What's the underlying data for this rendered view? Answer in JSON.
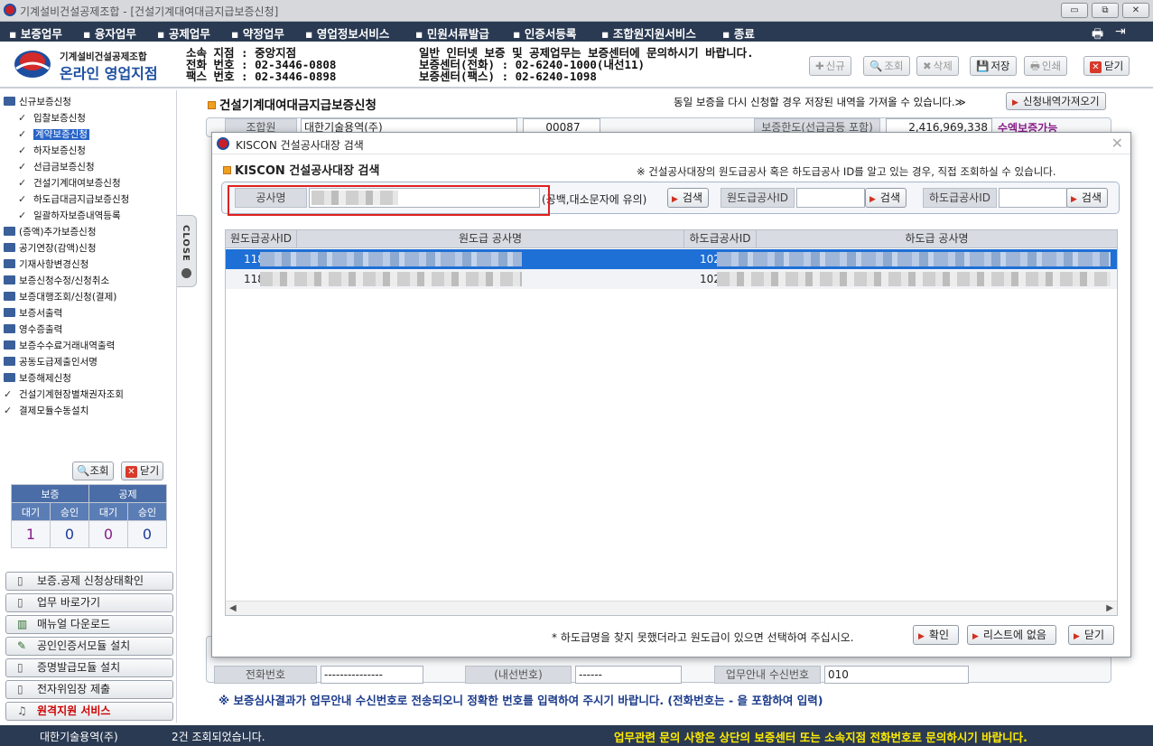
{
  "window": {
    "title": "기계설비건설공제조합 - [건설기계대여대금지급보증신청]",
    "controls": [
      "▭",
      "⧉",
      "✕"
    ]
  },
  "menu": {
    "items": [
      "보증업무",
      "융자업무",
      "공제업무",
      "약정업무",
      "영업정보서비스",
      "민원서류발급",
      "인증서등록",
      "조합원지원서비스",
      "종료"
    ]
  },
  "header": {
    "logo_top": "기계설비건설공제조합",
    "logo_main": "온라인 영업지점",
    "branch_lines": [
      "소속 지점 : 중앙지점",
      "전화 번호 : 02-3446-0808",
      "팩스 번호 : 02-3446-0898"
    ],
    "notice_lines": [
      "일반 인터넷 보증 및 공제업무는 보증센터에 문의하시기 바랍니다.",
      "보증센터(전화) : 02-6240-1000(내선11)",
      "보증센터(팩스) : 02-6240-1098"
    ],
    "buttons": {
      "new": "신규",
      "search": "조회",
      "delete": "삭제",
      "save": "저장",
      "print": "인쇄",
      "close": "닫기"
    }
  },
  "sidebar": {
    "tree": [
      {
        "label": "신규보증신청",
        "type": "folder"
      },
      {
        "label": "입찰보증신청",
        "type": "doc"
      },
      {
        "label": "계약보증신청",
        "type": "doc",
        "selected": true
      },
      {
        "label": "하자보증신청",
        "type": "doc"
      },
      {
        "label": "선급금보증신청",
        "type": "doc"
      },
      {
        "label": "건설기계대여보증신청",
        "type": "doc"
      },
      {
        "label": "하도급대금지급보증신청",
        "type": "doc"
      },
      {
        "label": "일괄하자보증내역등록",
        "type": "doc"
      },
      {
        "label": "(증액)추가보증신청",
        "type": "folder"
      },
      {
        "label": "공기연장(감액)신청",
        "type": "folder"
      },
      {
        "label": "기재사항변경신청",
        "type": "folder"
      },
      {
        "label": "보증신청수정/신청취소",
        "type": "folder"
      },
      {
        "label": "보증대행조회/신청(결제)",
        "type": "folder"
      },
      {
        "label": "보증서출력",
        "type": "folder"
      },
      {
        "label": "영수증출력",
        "type": "folder"
      },
      {
        "label": "보증수수료거래내역출력",
        "type": "folder"
      },
      {
        "label": "공동도급제출인서명",
        "type": "folder"
      },
      {
        "label": "보증해제신청",
        "type": "folder"
      },
      {
        "label": "건설기계현장별채권자조회",
        "type": "doc"
      },
      {
        "label": "결제모듈수동설치",
        "type": "doc"
      }
    ],
    "search_button": "조회",
    "close_button": "닫기",
    "stats": {
      "groups": [
        "보증",
        "공제"
      ],
      "subheads": [
        "대기",
        "승인",
        "대기",
        "승인"
      ],
      "values": [
        "1",
        "0",
        "0",
        "0"
      ]
    },
    "quick_links": [
      "보증.공제 신청상태확인",
      "업무 바로가기",
      "매뉴얼 다운로드",
      "공인인증서모듈 설치",
      "증명발급모듈 설치",
      "전자위임장 제출",
      "원격지원 서비스"
    ],
    "close_tab": "CLOSE"
  },
  "main": {
    "title": "건설기계대여대금지급보증신청",
    "note": "동일 보증을 다시 신청할 경우 저장된 내역을 가져올 수 있습니다.≫",
    "load_button": "신청내역가져오기",
    "top_row": {
      "label1": "조합원",
      "value1": "대한기술용역(주)",
      "value2": "00087",
      "label2": "보증한도(선급금등 포함)",
      "value3": "2,416,969,338",
      "status": "수엑보증가능"
    },
    "phone_label": "전화번호",
    "phone_value": "---------------",
    "ext_label": "(내선번호)",
    "ext_value": "------",
    "recv_label": "업무안내 수신번호",
    "recv_value": "010",
    "bottom_note": "※ 보증심사결과가 업무안내 수신번호로 전송되오니 정확한 번호를 입력하여 주시기 바랍니다. (전화번호는 - 을 포함하여 입력)"
  },
  "dialog": {
    "title": "KISCON 건설공사대장 검색",
    "heading": "KISCON 건설공사대장 검색",
    "note": "※ 건설공사대장의 원도급공사 혹은 하도급공사 ID를 알고 있는 경우, 직접 조회하실 수 있습니다.",
    "search": {
      "name_label": "공사명",
      "name_hint": "(공백,대소문자에 유의)",
      "search_button": "검색",
      "prime_id_label": "원도급공사ID",
      "sub_id_label": "하도급공사ID"
    },
    "grid": {
      "columns": [
        "원도급공사ID",
        "원도급 공사명",
        "하도급공사ID",
        "하도급 공사명"
      ],
      "rows": [
        {
          "prime_id": "118",
          "sub_id": "102",
          "selected": true
        },
        {
          "prime_id": "118",
          "sub_id": "102",
          "selected": false
        }
      ]
    },
    "footer_note": "* 하도급명을 찾지 못했더라고 원도급이 있으면 선택하여 주십시오.",
    "buttons": {
      "confirm": "확인",
      "not_in_list": "리스트에 없음",
      "close": "닫기"
    }
  },
  "status": {
    "company": "대한기술용역(주)",
    "count_text": "2건 조회되었습니다.",
    "notice": "업무관련 문의 사항은 상단의 보증센터 또는 소속지점 전화번호로 문의하시기 바랍니다."
  }
}
